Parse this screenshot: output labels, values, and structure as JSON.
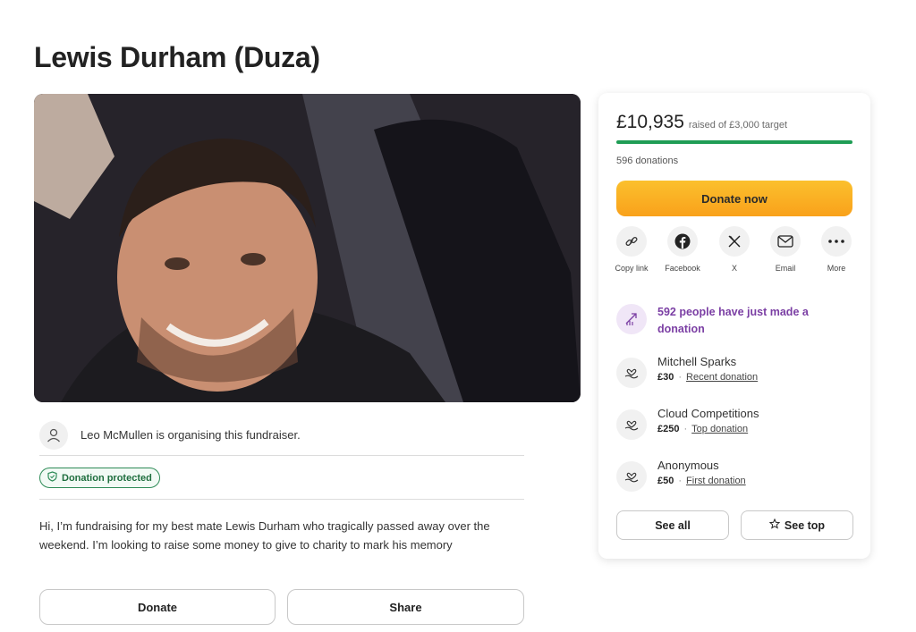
{
  "page": {
    "title": "Lewis Durham (Duza)"
  },
  "organiser": {
    "text": "Leo McMullen is organising this fundraiser.",
    "icon": "user-icon"
  },
  "badge": {
    "label": "Donation protected",
    "icon": "shield-icon",
    "color": "#2e8b57"
  },
  "story": {
    "text": "Hi, I’m fundraising for my best mate Lewis Durham who tragically passed away over the weekend. I’m looking to raise some money to give to charity to mark his memory"
  },
  "actions": {
    "donate_label": "Donate",
    "share_label": "Share"
  },
  "card": {
    "amount": "£10,935",
    "target_text": "raised of £3,000 target",
    "progress_fraction": 1.0,
    "donations_count": "596 donations",
    "donate_now_label": "Donate now",
    "accent_color": "#f9a11b",
    "share_options": [
      {
        "label": "Copy link",
        "icon": "link-icon"
      },
      {
        "label": "Facebook",
        "icon": "facebook-icon"
      },
      {
        "label": "X",
        "icon": "x-icon"
      },
      {
        "label": "Email",
        "icon": "email-icon"
      },
      {
        "label": "More",
        "icon": "more-icon"
      }
    ],
    "just_made": "592 people have just made a donation",
    "donors": [
      {
        "name": "Mitchell Sparks",
        "amount": "£30",
        "type": "Recent donation"
      },
      {
        "name": "Cloud Competitions",
        "amount": "£250",
        "type": "Top donation"
      },
      {
        "name": "Anonymous",
        "amount": "£50",
        "type": "First donation"
      }
    ],
    "see_all_label": "See all",
    "see_top_label": "See top"
  }
}
